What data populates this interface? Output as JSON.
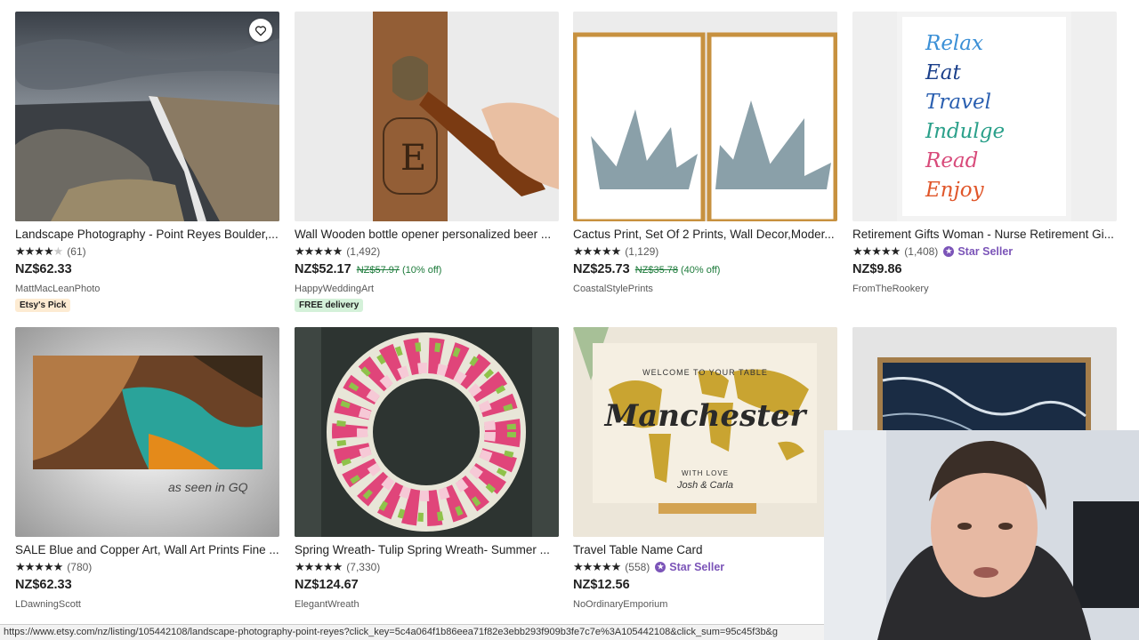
{
  "listings": [
    {
      "title": "Landscape Photography - Point Reyes Boulder,...",
      "stars_full": "★★★★",
      "stars_empty": "★",
      "reviews": "(61)",
      "price": "NZ$62.33",
      "original_price": "",
      "discount": "",
      "shop": "MattMacLeanPhoto",
      "badge": "Etsy's Pick",
      "star_seller": ""
    },
    {
      "title": "Wall Wooden bottle opener personalized beer ...",
      "stars_full": "★★★★★",
      "stars_empty": "",
      "reviews": "(1,492)",
      "price": "NZ$52.17",
      "original_price": "NZ$57.97",
      "discount": "(10% off)",
      "shop": "HappyWeddingArt",
      "badge": "FREE delivery",
      "star_seller": ""
    },
    {
      "title": "Cactus Print, Set Of 2 Prints, Wall Decor,Moder...",
      "stars_full": "★★★★★",
      "stars_empty": "",
      "reviews": "(1,129)",
      "price": "NZ$25.73",
      "original_price": "NZ$35.78",
      "discount": "(40% off)",
      "shop": "CoastalStylePrints",
      "badge": "",
      "star_seller": ""
    },
    {
      "title": "Retirement Gifts Woman - Nurse Retirement Gi...",
      "stars_full": "★★★★★",
      "stars_empty": "",
      "reviews": "(1,408)",
      "price": "NZ$9.86",
      "original_price": "",
      "discount": "",
      "shop": "FromTheRookery",
      "badge": "",
      "star_seller": "Star Seller"
    },
    {
      "title": "SALE Blue and Copper Art, Wall Art Prints Fine ...",
      "stars_full": "★★★★★",
      "stars_empty": "",
      "reviews": "(780)",
      "price": "NZ$62.33",
      "original_price": "",
      "discount": "",
      "shop": "LDawningScott",
      "badge": "",
      "star_seller": ""
    },
    {
      "title": "Spring Wreath- Tulip Spring Wreath- Summer ...",
      "stars_full": "★★★★★",
      "stars_empty": "",
      "reviews": "(7,330)",
      "price": "NZ$124.67",
      "original_price": "",
      "discount": "",
      "shop": "ElegantWreath",
      "badge": "",
      "star_seller": ""
    },
    {
      "title": "Travel Table Name Card",
      "stars_full": "★★★★★",
      "stars_empty": "",
      "reviews": "(558)",
      "price": "NZ$12.56",
      "original_price": "",
      "discount": "",
      "shop": "NoOrdinaryEmporium",
      "badge": "",
      "star_seller": "Star Seller"
    }
  ],
  "image_text": {
    "retirement_words": [
      "Relax",
      "Eat",
      "Travel",
      "Indulge",
      "Read",
      "Enjoy"
    ],
    "gq_caption": "as seen in GQ",
    "map_header": "WELCOME TO YOUR TABLE",
    "map_title": "Manchester",
    "map_with_love": "WITH LOVE",
    "map_names": "Josh & Carla",
    "bottle_letter": "E"
  },
  "status_bar": "https://www.etsy.com/nz/listing/105442108/landscape-photography-point-reyes?click_key=5c4a064f1b86eea71f82e3ebb293f909b3fe7c7e%3A105442108&click_sum=95c45f3b&g",
  "icons": {
    "favorite": "heart-outline-icon",
    "star_seller": "star-seller-badge-icon"
  }
}
